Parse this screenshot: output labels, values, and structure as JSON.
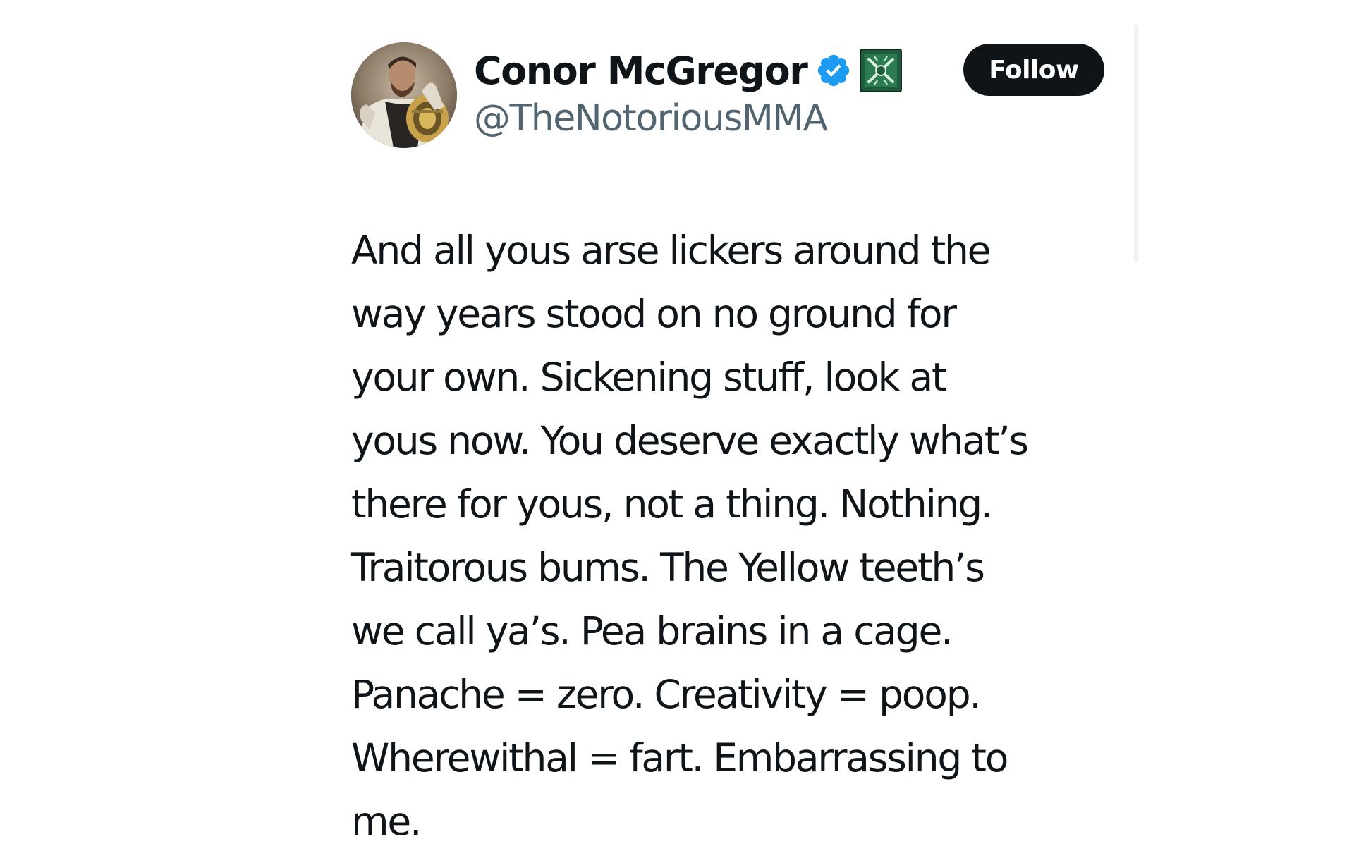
{
  "tweet": {
    "author": {
      "display_name": "Conor McGregor",
      "handle": "@TheNotoriousMMA",
      "verified_icon": "verified-badge-icon",
      "affiliate_icon": "affiliate-badge-icon",
      "avatar": "profile-photo"
    },
    "follow_label": "Follow",
    "text_lines": [
      "And all yous arse lickers around the",
      "way years stood on no ground for",
      "your own. Sickening stuff, look at",
      "yous now. You deserve exactly what’s",
      "there for yous, not a thing. Nothing.",
      "Traitorous bums. The Yellow teeth’s",
      "we call ya’s. Pea brains in a cage.",
      "Panache = zero. Creativity = poop.",
      "Wherewithal = fart. Embarrassing to",
      "me."
    ]
  },
  "colors": {
    "text_primary": "#0f1419",
    "text_secondary": "#536471",
    "verified_blue": "#1d9bf0",
    "affiliate_green": "#1f5a3b",
    "follow_button_bg": "#0f1419",
    "follow_button_text": "#ffffff"
  }
}
